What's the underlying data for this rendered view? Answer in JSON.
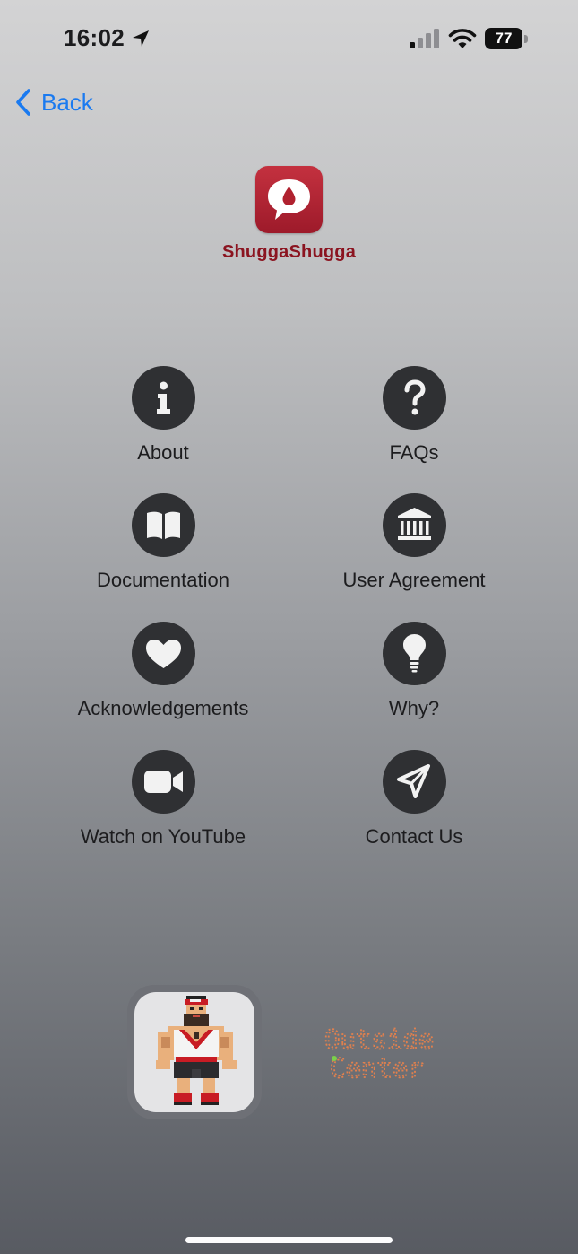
{
  "status_bar": {
    "time": "16:02",
    "battery_level": "77",
    "icons": [
      "location-arrow-icon",
      "cellular-signal-icon",
      "wifi-icon",
      "battery-icon"
    ]
  },
  "nav": {
    "back_label": "Back",
    "back_icon": "chevron-left-icon",
    "accent_color": "#1a7af0"
  },
  "app": {
    "name": "ShuggaShugga",
    "name_color": "#8b1420",
    "logo_icon": "speech-bubble-drop-icon",
    "logo_color": "#b0212f"
  },
  "menu": {
    "circle_color": "#2f3033",
    "items": [
      {
        "label": "About",
        "icon": "info-icon"
      },
      {
        "label": "FAQs",
        "icon": "question-mark-icon"
      },
      {
        "label": "Documentation",
        "icon": "book-icon"
      },
      {
        "label": "User Agreement",
        "icon": "building-columns-icon"
      },
      {
        "label": "Acknowledgements",
        "icon": "heart-icon"
      },
      {
        "label": "Why?",
        "icon": "lightbulb-icon"
      },
      {
        "label": "Watch on YouTube",
        "icon": "video-camera-icon"
      },
      {
        "label": "Contact Us",
        "icon": "paper-plane-icon"
      }
    ]
  },
  "footer": {
    "mascot_icon": "pixel-strongman-icon",
    "partner_logo_text": "Outside Center",
    "partner_logo_color": "#e0804e"
  }
}
